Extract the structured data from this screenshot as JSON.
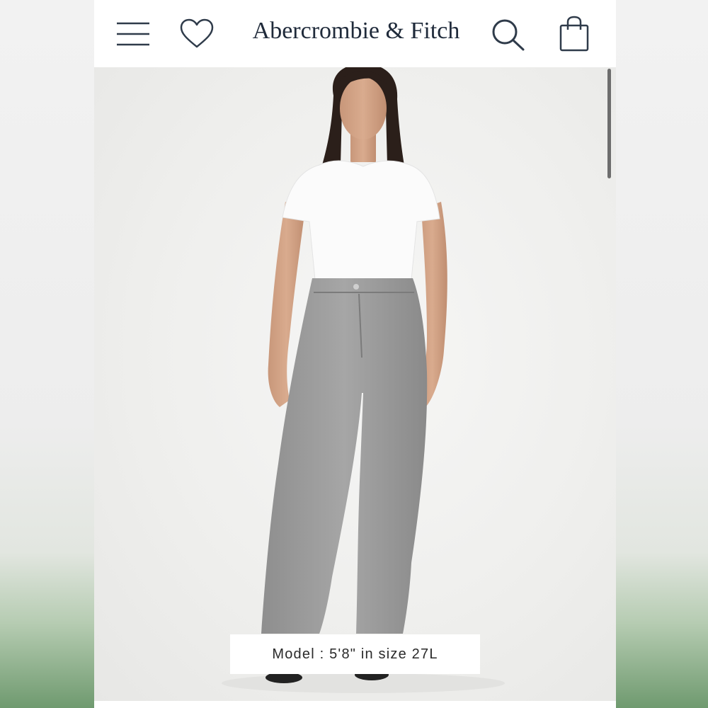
{
  "brand": {
    "logo_text": "Abercrombie & Fitch"
  },
  "header": {
    "icons": [
      "menu-icon",
      "heart-icon",
      "search-icon",
      "shopping-bag-icon"
    ]
  },
  "product_image": {
    "caption": "Model : 5'8\" in size 27L"
  },
  "colors": {
    "header_bg": "#ffffff",
    "brand_navy": "#1f2a3a",
    "icon_color": "#2f3b4a",
    "photo_bg": "#efefed"
  }
}
